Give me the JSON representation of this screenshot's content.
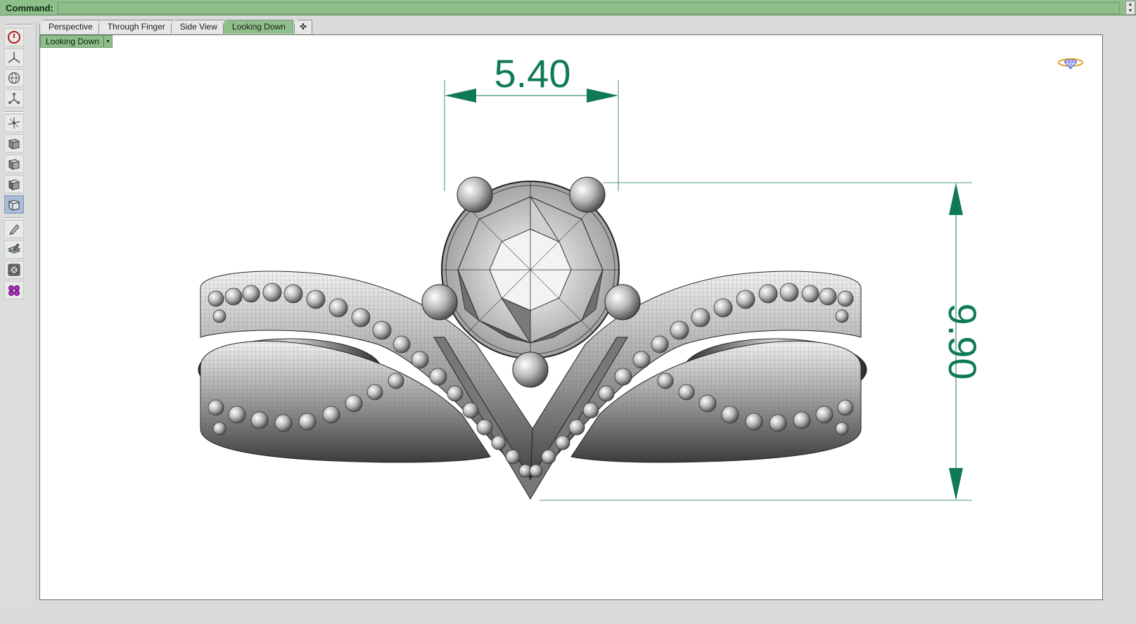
{
  "command_bar": {
    "label": "Command:",
    "value": ""
  },
  "toolbar": {
    "buttons": [
      {
        "icon": "power-icon"
      },
      {
        "icon": "axes-icon"
      },
      {
        "icon": "globe-icon"
      },
      {
        "icon": "nodes-icon"
      },
      {
        "icon": "move-axes-icon"
      },
      {
        "icon": "cube-wireframe-icon"
      },
      {
        "icon": "cube-shaded-icon"
      },
      {
        "icon": "cube-rendered-icon"
      },
      {
        "icon": "cube-ghosted-icon",
        "active": true
      },
      {
        "icon": "pen-icon"
      },
      {
        "icon": "layers-edit-icon"
      },
      {
        "icon": "zoom-extents-icon"
      },
      {
        "icon": "gear-cluster-icon"
      }
    ]
  },
  "tabs": [
    {
      "label": "Perspective",
      "active": false
    },
    {
      "label": "Through Finger",
      "active": false
    },
    {
      "label": "Side View",
      "active": false
    },
    {
      "label": "Looking Down",
      "active": true
    }
  ],
  "add_tab_label": "✜",
  "viewport": {
    "title": "Looking Down",
    "dropdown_glyph": "▼"
  },
  "dimensions": {
    "width_value": "5.40",
    "height_value": "9.90"
  },
  "colors": {
    "accent_green": "#8ebf8b",
    "dimension_green": "#0f7a55",
    "viewport_bg": "#ffffff"
  }
}
